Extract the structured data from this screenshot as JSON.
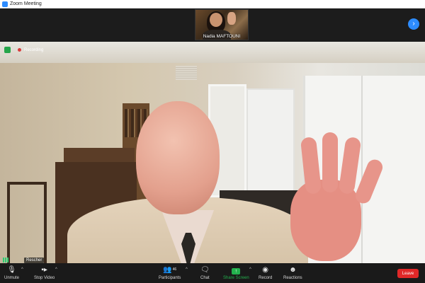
{
  "window": {
    "title": "Zoom Meeting"
  },
  "thumbnail": {
    "name": "Nadia MAFTOUNI"
  },
  "recording": {
    "label": "Recording"
  },
  "speaker": {
    "name": "Rescher"
  },
  "toolbar": {
    "unmute": "Unmute",
    "stop_video": "Stop Video",
    "participants": "Participants",
    "participants_count": "46",
    "chat": "Chat",
    "share_screen": "Share Screen",
    "record": "Record",
    "reactions": "Reactions",
    "leave": "Leave"
  },
  "colors": {
    "accent": "#2d8cff",
    "leave": "#e02828",
    "share": "#23b14d"
  },
  "icons": [
    "zoom-app-icon",
    "next-page-icon",
    "shield-icon",
    "recording-dot-icon",
    "signal-icon",
    "mic-muted-icon",
    "video-camera-icon",
    "participants-icon",
    "chat-icon",
    "share-screen-icon",
    "record-icon",
    "reactions-icon"
  ]
}
